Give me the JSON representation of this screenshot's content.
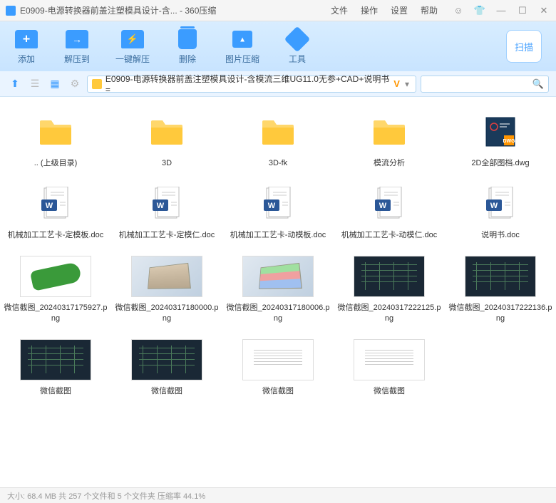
{
  "titlebar": {
    "title": "E0909-电源转换器前盖注塑模具设计-含... - 360压缩"
  },
  "menu": {
    "file": "文件",
    "operation": "操作",
    "settings": "设置",
    "help": "帮助"
  },
  "toolbar": {
    "add": "添加",
    "extract_to": "解压到",
    "onekey_extract": "一键解压",
    "delete": "删除",
    "image_compress": "图片压缩",
    "tools": "工具",
    "scan": "扫描"
  },
  "address": {
    "path": "E0909-电源转换器前盖注塑模具设计-含模流三维UG11.0无参+CAD+说明书="
  },
  "files": [
    {
      "name": ".. (上级目录)",
      "type": "folder"
    },
    {
      "name": "3D",
      "type": "folder"
    },
    {
      "name": "3D-fk",
      "type": "folder"
    },
    {
      "name": "模流分析",
      "type": "folder"
    },
    {
      "name": "2D全部图档.dwg",
      "type": "dwg"
    },
    {
      "name": "机械加工工艺卡-定模板.doc",
      "type": "doc"
    },
    {
      "name": "机械加工工艺卡-定模仁.doc",
      "type": "doc"
    },
    {
      "name": "机械加工工艺卡-动模板.doc",
      "type": "doc"
    },
    {
      "name": "机械加工工艺卡-动模仁.doc",
      "type": "doc"
    },
    {
      "name": "说明书.doc",
      "type": "doc"
    },
    {
      "name": "微信截图_20240317175927.png",
      "type": "thumb",
      "thumb": "green"
    },
    {
      "name": "微信截图_20240317180000.png",
      "type": "thumb",
      "thumb": "3d"
    },
    {
      "name": "微信截图_20240317180006.png",
      "type": "thumb",
      "thumb": "3dcolor"
    },
    {
      "name": "微信截图_20240317222125.png",
      "type": "thumb",
      "thumb": "cad"
    },
    {
      "name": "微信截图_20240317222136.png",
      "type": "thumb",
      "thumb": "cad"
    },
    {
      "name": "微信截图",
      "type": "thumb",
      "thumb": "cad"
    },
    {
      "name": "微信截图",
      "type": "thumb",
      "thumb": "cad"
    },
    {
      "name": "微信截图",
      "type": "thumb",
      "thumb": "sheet"
    },
    {
      "name": "微信截图",
      "type": "thumb",
      "thumb": "sheet"
    }
  ],
  "status": {
    "text": "大小: 68.4 MB 共 257 个文件和 5 个文件夹 压缩率 44.1%"
  }
}
